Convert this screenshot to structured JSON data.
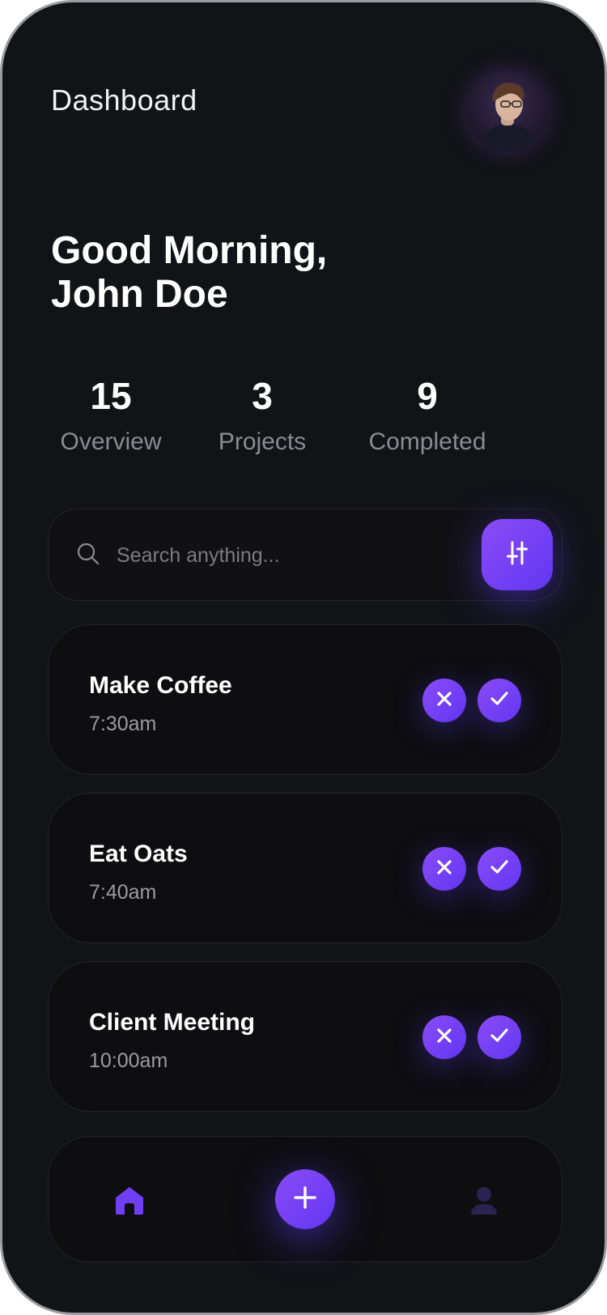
{
  "header": {
    "title": "Dashboard"
  },
  "greeting": {
    "line1": "Good Morning,",
    "line2": "John Doe"
  },
  "stats": [
    {
      "value": "15",
      "label": "Overview"
    },
    {
      "value": "3",
      "label": "Projects"
    },
    {
      "value": "9",
      "label": "Completed"
    }
  ],
  "search": {
    "placeholder": "Search anything...",
    "value": ""
  },
  "tasks": [
    {
      "title": "Make Coffee",
      "time": "7:30am"
    },
    {
      "title": "Eat Oats",
      "time": "7:40am"
    },
    {
      "title": "Client Meeting",
      "time": "10:00am"
    }
  ],
  "icons": {
    "search": "search-icon",
    "filter": "sliders-icon",
    "reject": "close-icon",
    "accept": "check-icon",
    "home": "home-icon",
    "add": "plus-icon",
    "profile": "user-icon"
  },
  "colors": {
    "background": "#121317",
    "accent": "#6f3ff5",
    "card": "#0e0e11",
    "text_muted": "#8b8b93"
  }
}
